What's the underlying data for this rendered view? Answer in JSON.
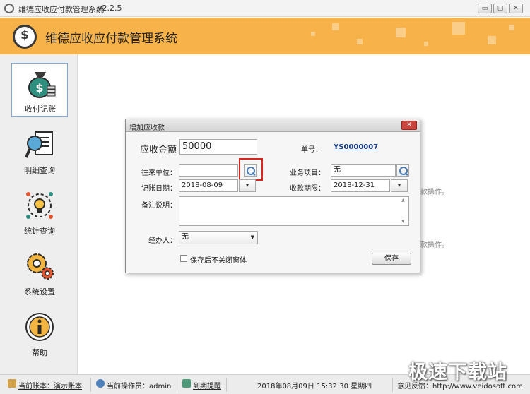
{
  "window": {
    "title": "维德应收应付款管理系统",
    "version": "v2.2.5",
    "minimize": "▭",
    "maximize": "▢",
    "close": "✕"
  },
  "header": {
    "app_name": "维德应收应付款管理系统"
  },
  "sidebar": {
    "items": [
      {
        "label": "收付记账",
        "icon": "money-bag-icon",
        "active": true
      },
      {
        "label": "明细查询",
        "icon": "magnifier-document-icon"
      },
      {
        "label": "统计查询",
        "icon": "lightbulb-cycle-icon"
      },
      {
        "label": "系统设置",
        "icon": "gears-icon"
      },
      {
        "label": "帮助",
        "icon": "info-icon"
      }
    ]
  },
  "main": {
    "hint_1": "款操作。",
    "hint_2": "款操作。"
  },
  "dialog": {
    "title": "增加应收款",
    "close": "✕",
    "amount_label": "应收金额",
    "amount_value": "50000",
    "order_no_label": "单号：",
    "order_no_value": "YS0000007",
    "partner_label": "往来单位：",
    "partner_value": "",
    "project_label": "业务项目：",
    "project_value": "无",
    "date_label": "记账日期：",
    "date_value": "2018-08-09",
    "due_label": "收款期限：",
    "due_value": "2018-12-31",
    "remark_label": "备注说明：",
    "remark_value": "",
    "handler_label": "经办人：",
    "handler_value": "无",
    "keep_open_label": "保存后不关闭窗体",
    "save_label": "保存",
    "scroll_up": "▲",
    "scroll_down": "▼",
    "dropdown_arrow": "▼",
    "calendar_arrow": "▾"
  },
  "statusbar": {
    "account_label": "当前账本：演示账本",
    "operator_label": "当前操作员：admin",
    "reminder_label": "到期提醒",
    "datetime": "2018年08月09日  15:32:30  星期四",
    "feedback_label": "意见反馈：http://www.veidosoft.com"
  },
  "watermark": {
    "text": "极速下载站"
  },
  "colors": {
    "header": "#f8b24a",
    "accent_red": "#d9261c",
    "order_no": "#1a3f8a"
  }
}
